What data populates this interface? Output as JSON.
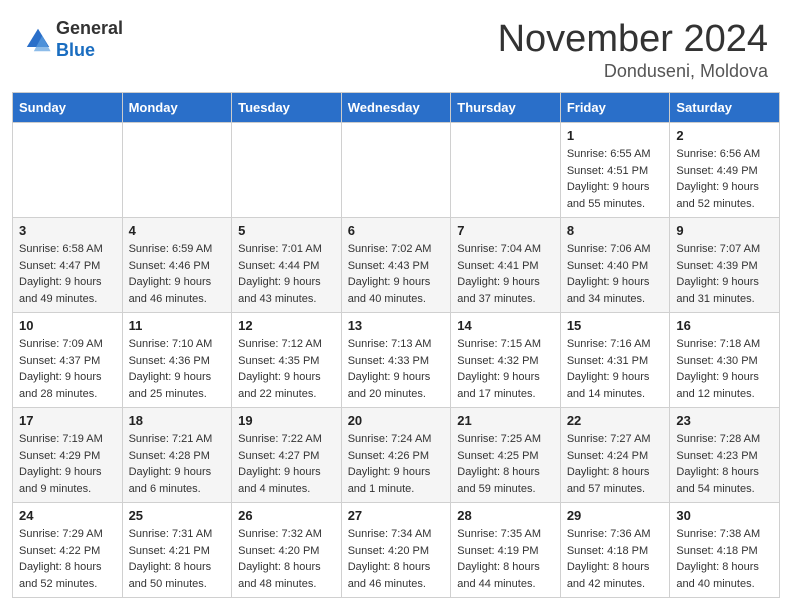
{
  "header": {
    "logo_general": "General",
    "logo_blue": "Blue",
    "month_title": "November 2024",
    "location": "Donduseni, Moldova"
  },
  "calendar": {
    "weekdays": [
      "Sunday",
      "Monday",
      "Tuesday",
      "Wednesday",
      "Thursday",
      "Friday",
      "Saturday"
    ],
    "weeks": [
      [
        {
          "day": "",
          "sunrise": "",
          "sunset": "",
          "daylight": ""
        },
        {
          "day": "",
          "sunrise": "",
          "sunset": "",
          "daylight": ""
        },
        {
          "day": "",
          "sunrise": "",
          "sunset": "",
          "daylight": ""
        },
        {
          "day": "",
          "sunrise": "",
          "sunset": "",
          "daylight": ""
        },
        {
          "day": "",
          "sunrise": "",
          "sunset": "",
          "daylight": ""
        },
        {
          "day": "1",
          "sunrise": "Sunrise: 6:55 AM",
          "sunset": "Sunset: 4:51 PM",
          "daylight": "Daylight: 9 hours and 55 minutes."
        },
        {
          "day": "2",
          "sunrise": "Sunrise: 6:56 AM",
          "sunset": "Sunset: 4:49 PM",
          "daylight": "Daylight: 9 hours and 52 minutes."
        }
      ],
      [
        {
          "day": "3",
          "sunrise": "Sunrise: 6:58 AM",
          "sunset": "Sunset: 4:47 PM",
          "daylight": "Daylight: 9 hours and 49 minutes."
        },
        {
          "day": "4",
          "sunrise": "Sunrise: 6:59 AM",
          "sunset": "Sunset: 4:46 PM",
          "daylight": "Daylight: 9 hours and 46 minutes."
        },
        {
          "day": "5",
          "sunrise": "Sunrise: 7:01 AM",
          "sunset": "Sunset: 4:44 PM",
          "daylight": "Daylight: 9 hours and 43 minutes."
        },
        {
          "day": "6",
          "sunrise": "Sunrise: 7:02 AM",
          "sunset": "Sunset: 4:43 PM",
          "daylight": "Daylight: 9 hours and 40 minutes."
        },
        {
          "day": "7",
          "sunrise": "Sunrise: 7:04 AM",
          "sunset": "Sunset: 4:41 PM",
          "daylight": "Daylight: 9 hours and 37 minutes."
        },
        {
          "day": "8",
          "sunrise": "Sunrise: 7:06 AM",
          "sunset": "Sunset: 4:40 PM",
          "daylight": "Daylight: 9 hours and 34 minutes."
        },
        {
          "day": "9",
          "sunrise": "Sunrise: 7:07 AM",
          "sunset": "Sunset: 4:39 PM",
          "daylight": "Daylight: 9 hours and 31 minutes."
        }
      ],
      [
        {
          "day": "10",
          "sunrise": "Sunrise: 7:09 AM",
          "sunset": "Sunset: 4:37 PM",
          "daylight": "Daylight: 9 hours and 28 minutes."
        },
        {
          "day": "11",
          "sunrise": "Sunrise: 7:10 AM",
          "sunset": "Sunset: 4:36 PM",
          "daylight": "Daylight: 9 hours and 25 minutes."
        },
        {
          "day": "12",
          "sunrise": "Sunrise: 7:12 AM",
          "sunset": "Sunset: 4:35 PM",
          "daylight": "Daylight: 9 hours and 22 minutes."
        },
        {
          "day": "13",
          "sunrise": "Sunrise: 7:13 AM",
          "sunset": "Sunset: 4:33 PM",
          "daylight": "Daylight: 9 hours and 20 minutes."
        },
        {
          "day": "14",
          "sunrise": "Sunrise: 7:15 AM",
          "sunset": "Sunset: 4:32 PM",
          "daylight": "Daylight: 9 hours and 17 minutes."
        },
        {
          "day": "15",
          "sunrise": "Sunrise: 7:16 AM",
          "sunset": "Sunset: 4:31 PM",
          "daylight": "Daylight: 9 hours and 14 minutes."
        },
        {
          "day": "16",
          "sunrise": "Sunrise: 7:18 AM",
          "sunset": "Sunset: 4:30 PM",
          "daylight": "Daylight: 9 hours and 12 minutes."
        }
      ],
      [
        {
          "day": "17",
          "sunrise": "Sunrise: 7:19 AM",
          "sunset": "Sunset: 4:29 PM",
          "daylight": "Daylight: 9 hours and 9 minutes."
        },
        {
          "day": "18",
          "sunrise": "Sunrise: 7:21 AM",
          "sunset": "Sunset: 4:28 PM",
          "daylight": "Daylight: 9 hours and 6 minutes."
        },
        {
          "day": "19",
          "sunrise": "Sunrise: 7:22 AM",
          "sunset": "Sunset: 4:27 PM",
          "daylight": "Daylight: 9 hours and 4 minutes."
        },
        {
          "day": "20",
          "sunrise": "Sunrise: 7:24 AM",
          "sunset": "Sunset: 4:26 PM",
          "daylight": "Daylight: 9 hours and 1 minute."
        },
        {
          "day": "21",
          "sunrise": "Sunrise: 7:25 AM",
          "sunset": "Sunset: 4:25 PM",
          "daylight": "Daylight: 8 hours and 59 minutes."
        },
        {
          "day": "22",
          "sunrise": "Sunrise: 7:27 AM",
          "sunset": "Sunset: 4:24 PM",
          "daylight": "Daylight: 8 hours and 57 minutes."
        },
        {
          "day": "23",
          "sunrise": "Sunrise: 7:28 AM",
          "sunset": "Sunset: 4:23 PM",
          "daylight": "Daylight: 8 hours and 54 minutes."
        }
      ],
      [
        {
          "day": "24",
          "sunrise": "Sunrise: 7:29 AM",
          "sunset": "Sunset: 4:22 PM",
          "daylight": "Daylight: 8 hours and 52 minutes."
        },
        {
          "day": "25",
          "sunrise": "Sunrise: 7:31 AM",
          "sunset": "Sunset: 4:21 PM",
          "daylight": "Daylight: 8 hours and 50 minutes."
        },
        {
          "day": "26",
          "sunrise": "Sunrise: 7:32 AM",
          "sunset": "Sunset: 4:20 PM",
          "daylight": "Daylight: 8 hours and 48 minutes."
        },
        {
          "day": "27",
          "sunrise": "Sunrise: 7:34 AM",
          "sunset": "Sunset: 4:20 PM",
          "daylight": "Daylight: 8 hours and 46 minutes."
        },
        {
          "day": "28",
          "sunrise": "Sunrise: 7:35 AM",
          "sunset": "Sunset: 4:19 PM",
          "daylight": "Daylight: 8 hours and 44 minutes."
        },
        {
          "day": "29",
          "sunrise": "Sunrise: 7:36 AM",
          "sunset": "Sunset: 4:18 PM",
          "daylight": "Daylight: 8 hours and 42 minutes."
        },
        {
          "day": "30",
          "sunrise": "Sunrise: 7:38 AM",
          "sunset": "Sunset: 4:18 PM",
          "daylight": "Daylight: 8 hours and 40 minutes."
        }
      ]
    ]
  }
}
